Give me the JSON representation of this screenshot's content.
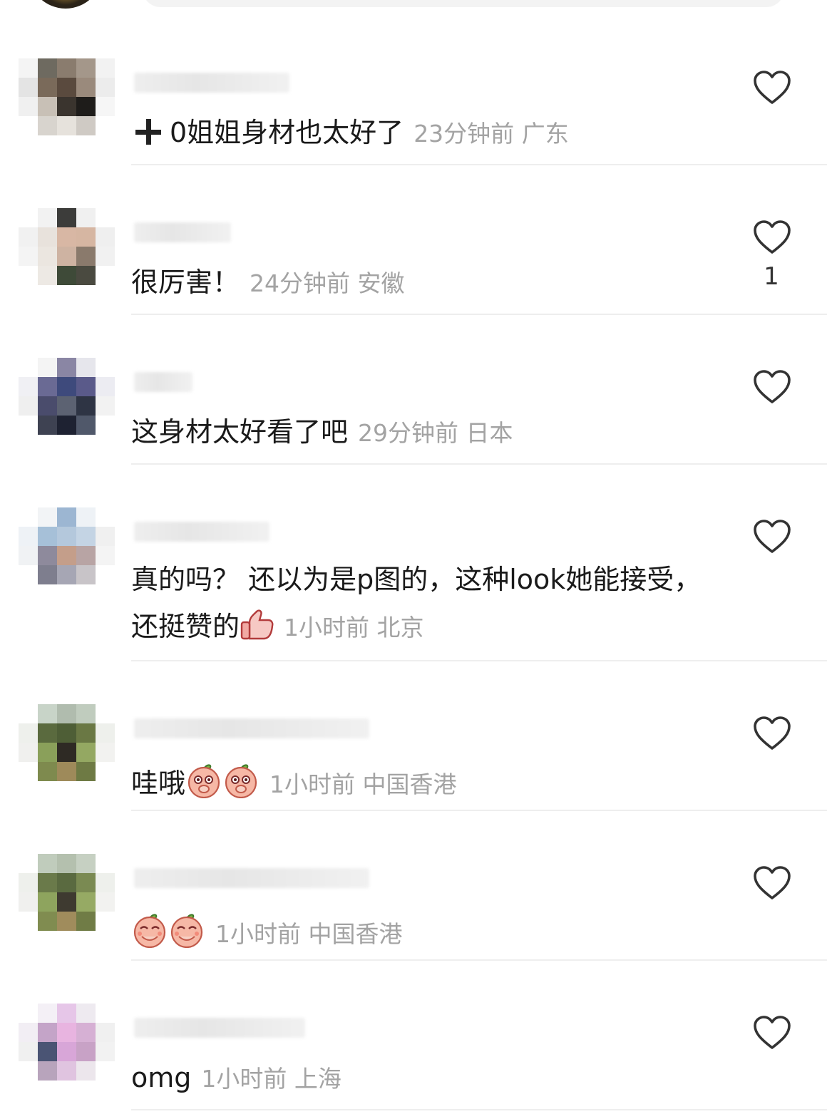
{
  "comments": [
    {
      "text": "0姐姐身材也太好了",
      "time": "23分钟前",
      "location": "广东",
      "like_count": ""
    },
    {
      "text": "很厉害！",
      "time": "24分钟前",
      "location": "安徽",
      "like_count": "1"
    },
    {
      "text": "这身材太好看了吧",
      "time": "29分钟前",
      "location": "日本",
      "like_count": ""
    },
    {
      "text": "真的吗？ 还以为是p图的，这种look她能接受，还挺赞的",
      "time": "1小时前",
      "location": "北京",
      "like_count": ""
    },
    {
      "text": "哇哦",
      "time": "1小时前",
      "location": "中国香港",
      "like_count": ""
    },
    {
      "text": "",
      "time": "1小时前",
      "location": "中国香港",
      "like_count": ""
    },
    {
      "text": "omg",
      "time": "1小时前",
      "location": "上海",
      "like_count": ""
    }
  ],
  "colors": {
    "meta_text": "#a3a3a3",
    "divider": "#eeeeee",
    "heart_outline": "#333333"
  },
  "icons": {
    "like": "heart-outline-icon",
    "plus": "plus-icon",
    "thumbs_up": "thumbs-up-emoji",
    "peach": "peach-face-emoji"
  }
}
